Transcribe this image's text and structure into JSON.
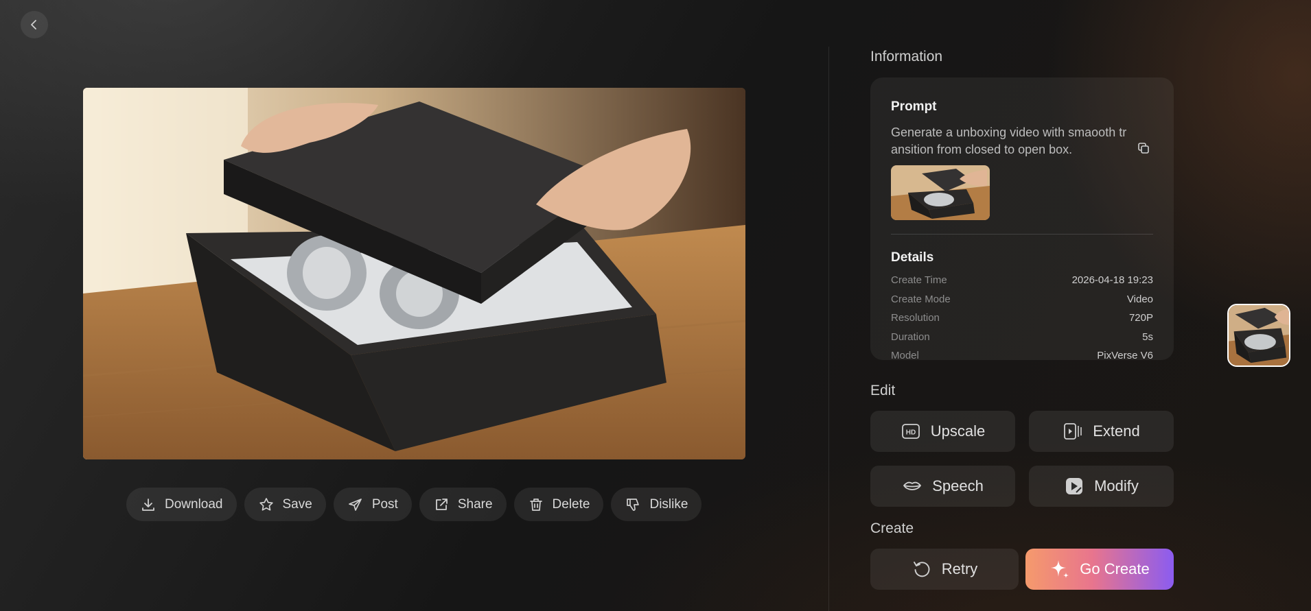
{
  "nav": {
    "back_icon": "chevron-left-icon"
  },
  "actions": [
    {
      "label": "Download",
      "icon": "download-icon"
    },
    {
      "label": "Save",
      "icon": "star-icon"
    },
    {
      "label": "Post",
      "icon": "send-icon"
    },
    {
      "label": "Share",
      "icon": "share-icon"
    },
    {
      "label": "Delete",
      "icon": "trash-icon"
    },
    {
      "label": "Dislike",
      "icon": "thumbs-down-icon"
    }
  ],
  "info": {
    "title": "Information",
    "prompt_heading": "Prompt",
    "prompt_text": "Generate a unboxing video with smaooth transition from closed to open box.",
    "details_heading": "Details",
    "details": [
      {
        "key": "Create Time",
        "value": "2026-04-18 19:23"
      },
      {
        "key": "Create Mode",
        "value": "Video"
      },
      {
        "key": "Resolution",
        "value": "720P"
      },
      {
        "key": "Duration",
        "value": "5s"
      },
      {
        "key": "Model",
        "value": "PixVerse V6"
      }
    ]
  },
  "edit": {
    "title": "Edit",
    "upscale": "Upscale",
    "extend": "Extend",
    "speech": "Speech",
    "modify": "Modify"
  },
  "create": {
    "title": "Create",
    "retry": "Retry",
    "go_create": "Go Create"
  },
  "colors": {
    "go_create_gradient": [
      "#f59a6c",
      "#e8758d",
      "#8b5cf0"
    ],
    "background": "#161616"
  }
}
